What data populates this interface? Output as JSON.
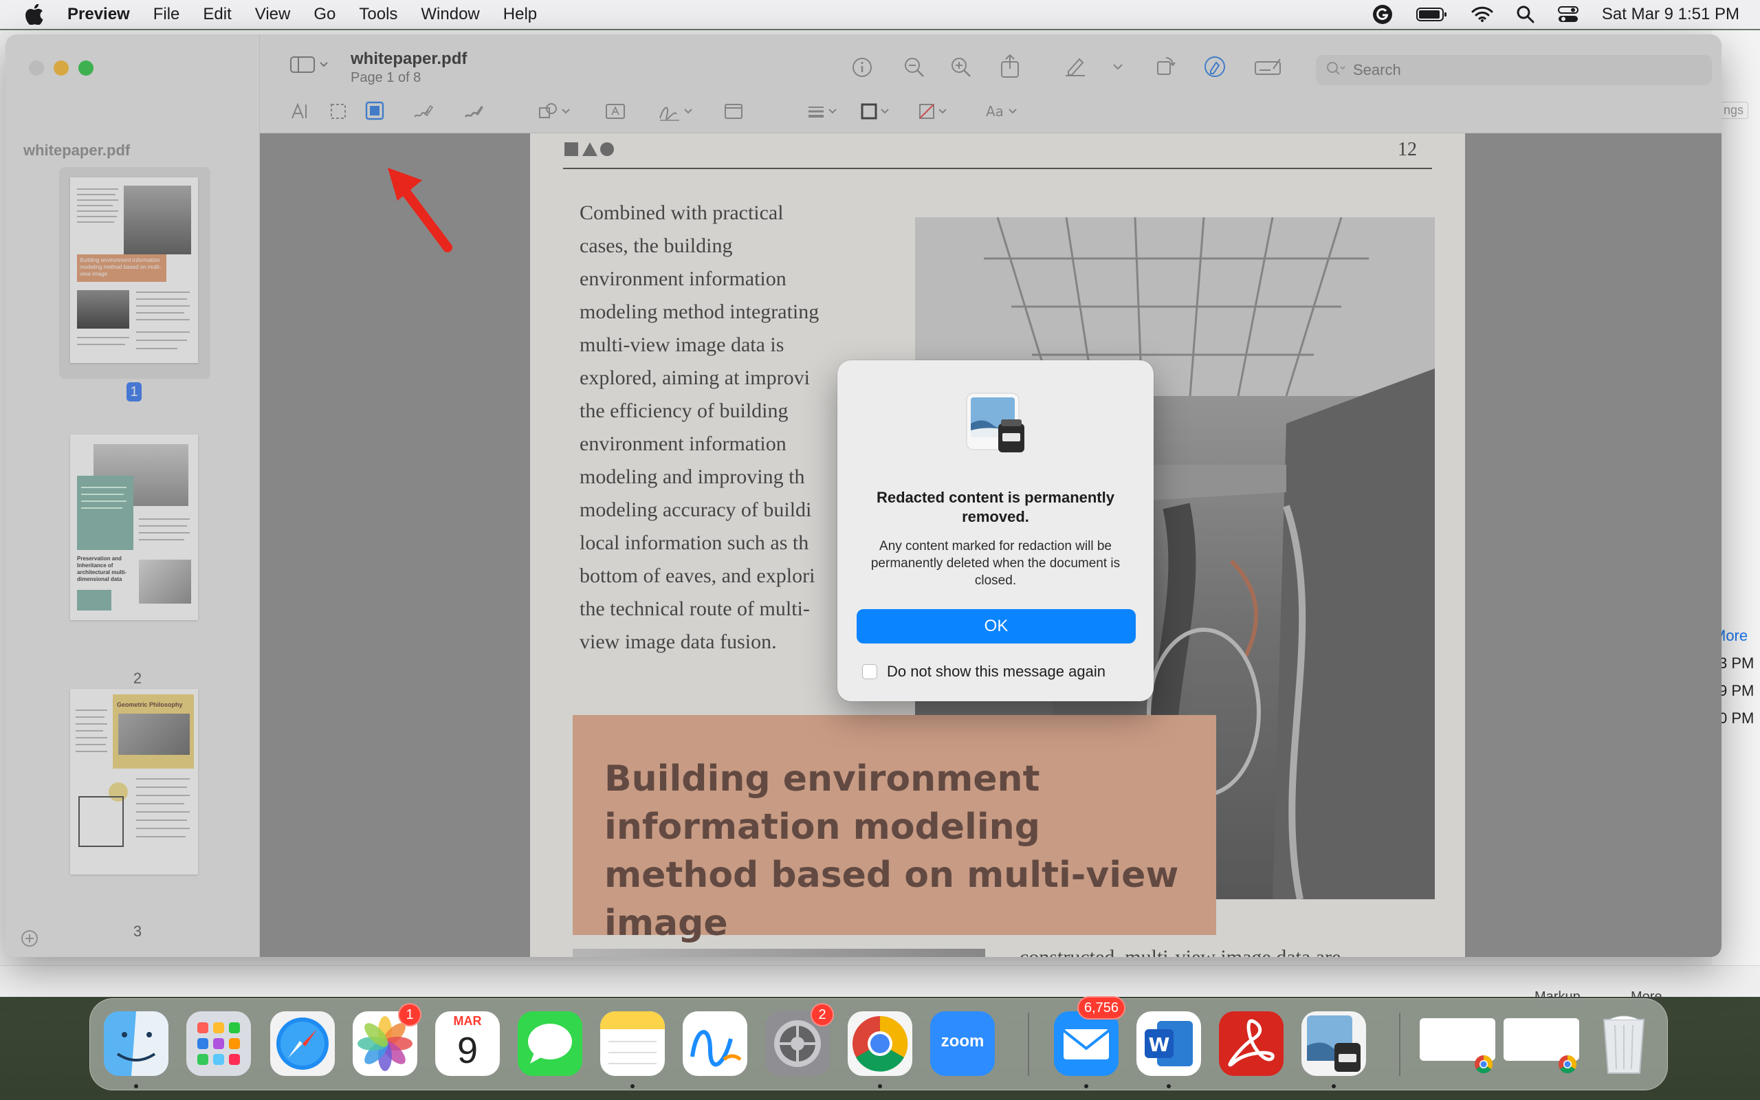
{
  "menubar": {
    "app_name": "Preview",
    "items": [
      "File",
      "Edit",
      "View",
      "Go",
      "Tools",
      "Window",
      "Help"
    ],
    "datetime": "Sat Mar 9  1:51 PM"
  },
  "background_window": {
    "more_link": "More",
    "times": [
      "3 PM",
      "9 PM",
      "0 PM"
    ],
    "ngs_label": "ngs",
    "bottom_labels": [
      "Markup",
      "More..."
    ]
  },
  "preview": {
    "title": "whitepaper.pdf",
    "subtitle": "Page 1 of 8",
    "search_placeholder": "Search",
    "sidebar_title": "whitepaper.pdf",
    "thumbnails": [
      {
        "number": "1",
        "caption": "Building environment information modeling method based on multi-view image"
      },
      {
        "number": "2",
        "caption": "Preservation and Inheritance of architectural multi-dimensional data"
      },
      {
        "number": "3",
        "caption": "Geometric Philosophy"
      }
    ],
    "page": {
      "number": "12",
      "body_lines": [
        "Combined with practical",
        "cases, the building",
        "environment information",
        "modeling method integrating",
        "multi-view image data is",
        "explored, aiming at improvi",
        "the efficiency of building",
        "environment information",
        "modeling and improving th",
        "modeling accuracy of buildi",
        "local information such as th",
        "bottom of eaves, and explori",
        "the technical route of multi-",
        "view image data fusion."
      ],
      "heading": "Building environment information modeling method based on multi-view image",
      "bottom_text": "constructed, multi-view image data are"
    }
  },
  "dialog": {
    "title": "Redacted content is permanently removed.",
    "message": "Any content marked for redaction will be permanently deleted when the document is closed.",
    "ok_label": "OK",
    "checkbox_label": "Do not show this message again"
  },
  "dock": {
    "calendar_month": "MAR",
    "calendar_day": "9",
    "zoom_label": "zoom",
    "badges": {
      "photos": "1",
      "settings": "2",
      "mail": "6,756"
    }
  },
  "colors": {
    "accent": "#0a84ff",
    "arrow": "#e8261c",
    "heading_box": "#e8a98a"
  }
}
